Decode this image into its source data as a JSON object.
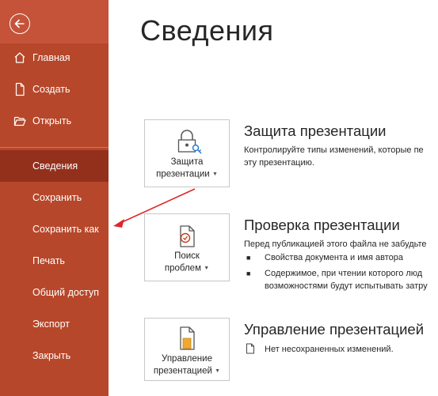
{
  "sidebar": {
    "items": [
      {
        "label": "Главная",
        "icon": "home-icon"
      },
      {
        "label": "Создать",
        "icon": "new-file-icon"
      },
      {
        "label": "Открыть",
        "icon": "folder-open-icon"
      },
      {
        "label": "Сведения",
        "active": true
      },
      {
        "label": "Сохранить"
      },
      {
        "label": "Сохранить как"
      },
      {
        "label": "Печать"
      },
      {
        "label": "Общий доступ"
      },
      {
        "label": "Экспорт"
      },
      {
        "label": "Закрыть"
      }
    ]
  },
  "main": {
    "title": "Сведения",
    "protect": {
      "tile_line1": "Защита",
      "tile_line2": "презентации",
      "title": "Защита презентации",
      "line1": "Контролируйте типы изменений, которые пе",
      "line2": "эту презентацию."
    },
    "inspect": {
      "tile_line1": "Поиск",
      "tile_line2": "проблем",
      "title": "Проверка презентации",
      "line1": "Перед публикацией этого файла не забудьте",
      "bullet1": "Свойства документа и имя автора",
      "bullet2_line1": "Содержимое, при чтении которого люд",
      "bullet2_line2": "возможностями будут испытывать затру"
    },
    "manage": {
      "tile_line1": "Управление",
      "tile_line2": "презентацией",
      "title": "Управление презентацией",
      "line1": "Нет несохраненных изменений."
    }
  },
  "colors": {
    "sidebar": "#b7472a",
    "sidebar_active": "#93301c",
    "arrow": "#e0262b"
  }
}
